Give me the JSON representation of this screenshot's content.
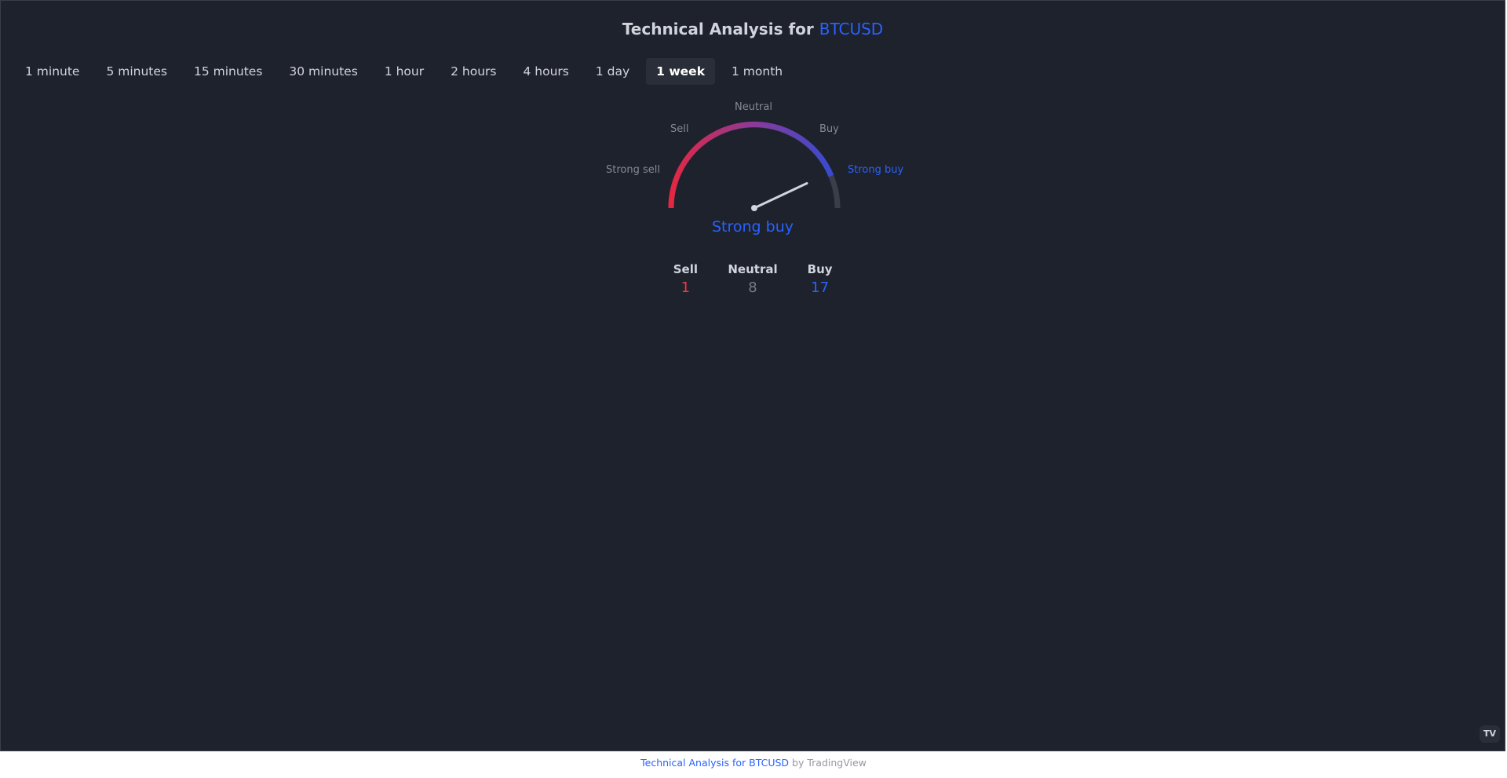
{
  "header": {
    "title_prefix": "Technical Analysis for ",
    "symbol": "BTCUSD"
  },
  "tabs": [
    {
      "label": "1 minute",
      "active": false
    },
    {
      "label": "5 minutes",
      "active": false
    },
    {
      "label": "15 minutes",
      "active": false
    },
    {
      "label": "30 minutes",
      "active": false
    },
    {
      "label": "1 hour",
      "active": false
    },
    {
      "label": "2 hours",
      "active": false
    },
    {
      "label": "4 hours",
      "active": false
    },
    {
      "label": "1 day",
      "active": false
    },
    {
      "label": "1 week",
      "active": true
    },
    {
      "label": "1 month",
      "active": false
    }
  ],
  "gauge": {
    "labels": {
      "strong_sell": "Strong sell",
      "sell": "Sell",
      "neutral": "Neutral",
      "buy": "Buy",
      "strong_buy": "Strong buy"
    },
    "active_label": "strong_buy",
    "needle_value": 0.86,
    "verdict": "Strong buy"
  },
  "summary": {
    "sell": {
      "label": "Sell",
      "value": "1"
    },
    "neutral": {
      "label": "Neutral",
      "value": "8"
    },
    "buy": {
      "label": "Buy",
      "value": "17"
    }
  },
  "footer": {
    "link_text": "Technical Analysis for BTCUSD",
    "by_text": " by TradingView"
  },
  "logo": {
    "text": "TV",
    "icon": "tradingview-logo-icon"
  },
  "colors": {
    "background": "#1e222d",
    "accent": "#2962ff",
    "sell": "#f23645",
    "neutral": "#787b86"
  }
}
